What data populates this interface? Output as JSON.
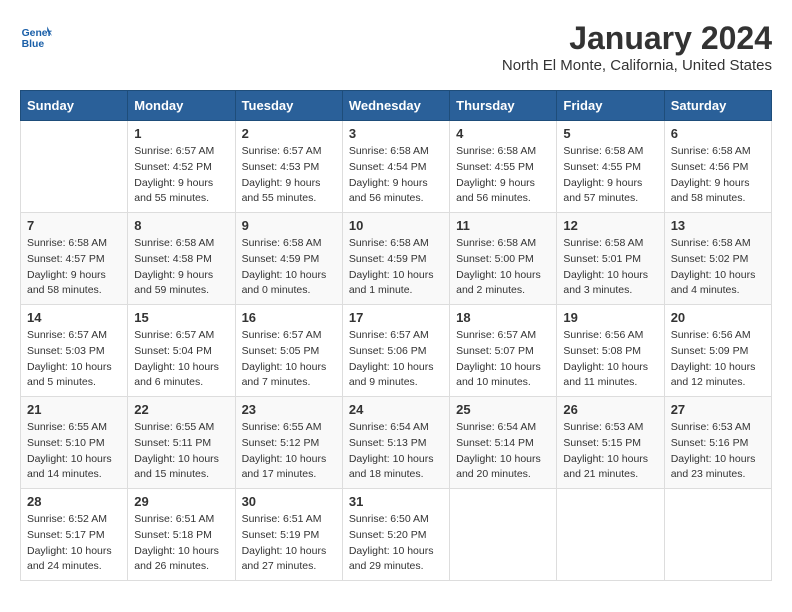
{
  "header": {
    "logo_line1": "General",
    "logo_line2": "Blue",
    "title": "January 2024",
    "subtitle": "North El Monte, California, United States"
  },
  "days_of_week": [
    "Sunday",
    "Monday",
    "Tuesday",
    "Wednesday",
    "Thursday",
    "Friday",
    "Saturday"
  ],
  "weeks": [
    [
      {
        "day": "",
        "info": ""
      },
      {
        "day": "1",
        "info": "Sunrise: 6:57 AM\nSunset: 4:52 PM\nDaylight: 9 hours\nand 55 minutes."
      },
      {
        "day": "2",
        "info": "Sunrise: 6:57 AM\nSunset: 4:53 PM\nDaylight: 9 hours\nand 55 minutes."
      },
      {
        "day": "3",
        "info": "Sunrise: 6:58 AM\nSunset: 4:54 PM\nDaylight: 9 hours\nand 56 minutes."
      },
      {
        "day": "4",
        "info": "Sunrise: 6:58 AM\nSunset: 4:55 PM\nDaylight: 9 hours\nand 56 minutes."
      },
      {
        "day": "5",
        "info": "Sunrise: 6:58 AM\nSunset: 4:55 PM\nDaylight: 9 hours\nand 57 minutes."
      },
      {
        "day": "6",
        "info": "Sunrise: 6:58 AM\nSunset: 4:56 PM\nDaylight: 9 hours\nand 58 minutes."
      }
    ],
    [
      {
        "day": "7",
        "info": "Sunrise: 6:58 AM\nSunset: 4:57 PM\nDaylight: 9 hours\nand 58 minutes."
      },
      {
        "day": "8",
        "info": "Sunrise: 6:58 AM\nSunset: 4:58 PM\nDaylight: 9 hours\nand 59 minutes."
      },
      {
        "day": "9",
        "info": "Sunrise: 6:58 AM\nSunset: 4:59 PM\nDaylight: 10 hours\nand 0 minutes."
      },
      {
        "day": "10",
        "info": "Sunrise: 6:58 AM\nSunset: 4:59 PM\nDaylight: 10 hours\nand 1 minute."
      },
      {
        "day": "11",
        "info": "Sunrise: 6:58 AM\nSunset: 5:00 PM\nDaylight: 10 hours\nand 2 minutes."
      },
      {
        "day": "12",
        "info": "Sunrise: 6:58 AM\nSunset: 5:01 PM\nDaylight: 10 hours\nand 3 minutes."
      },
      {
        "day": "13",
        "info": "Sunrise: 6:58 AM\nSunset: 5:02 PM\nDaylight: 10 hours\nand 4 minutes."
      }
    ],
    [
      {
        "day": "14",
        "info": "Sunrise: 6:57 AM\nSunset: 5:03 PM\nDaylight: 10 hours\nand 5 minutes."
      },
      {
        "day": "15",
        "info": "Sunrise: 6:57 AM\nSunset: 5:04 PM\nDaylight: 10 hours\nand 6 minutes."
      },
      {
        "day": "16",
        "info": "Sunrise: 6:57 AM\nSunset: 5:05 PM\nDaylight: 10 hours\nand 7 minutes."
      },
      {
        "day": "17",
        "info": "Sunrise: 6:57 AM\nSunset: 5:06 PM\nDaylight: 10 hours\nand 9 minutes."
      },
      {
        "day": "18",
        "info": "Sunrise: 6:57 AM\nSunset: 5:07 PM\nDaylight: 10 hours\nand 10 minutes."
      },
      {
        "day": "19",
        "info": "Sunrise: 6:56 AM\nSunset: 5:08 PM\nDaylight: 10 hours\nand 11 minutes."
      },
      {
        "day": "20",
        "info": "Sunrise: 6:56 AM\nSunset: 5:09 PM\nDaylight: 10 hours\nand 12 minutes."
      }
    ],
    [
      {
        "day": "21",
        "info": "Sunrise: 6:55 AM\nSunset: 5:10 PM\nDaylight: 10 hours\nand 14 minutes."
      },
      {
        "day": "22",
        "info": "Sunrise: 6:55 AM\nSunset: 5:11 PM\nDaylight: 10 hours\nand 15 minutes."
      },
      {
        "day": "23",
        "info": "Sunrise: 6:55 AM\nSunset: 5:12 PM\nDaylight: 10 hours\nand 17 minutes."
      },
      {
        "day": "24",
        "info": "Sunrise: 6:54 AM\nSunset: 5:13 PM\nDaylight: 10 hours\nand 18 minutes."
      },
      {
        "day": "25",
        "info": "Sunrise: 6:54 AM\nSunset: 5:14 PM\nDaylight: 10 hours\nand 20 minutes."
      },
      {
        "day": "26",
        "info": "Sunrise: 6:53 AM\nSunset: 5:15 PM\nDaylight: 10 hours\nand 21 minutes."
      },
      {
        "day": "27",
        "info": "Sunrise: 6:53 AM\nSunset: 5:16 PM\nDaylight: 10 hours\nand 23 minutes."
      }
    ],
    [
      {
        "day": "28",
        "info": "Sunrise: 6:52 AM\nSunset: 5:17 PM\nDaylight: 10 hours\nand 24 minutes."
      },
      {
        "day": "29",
        "info": "Sunrise: 6:51 AM\nSunset: 5:18 PM\nDaylight: 10 hours\nand 26 minutes."
      },
      {
        "day": "30",
        "info": "Sunrise: 6:51 AM\nSunset: 5:19 PM\nDaylight: 10 hours\nand 27 minutes."
      },
      {
        "day": "31",
        "info": "Sunrise: 6:50 AM\nSunset: 5:20 PM\nDaylight: 10 hours\nand 29 minutes."
      },
      {
        "day": "",
        "info": ""
      },
      {
        "day": "",
        "info": ""
      },
      {
        "day": "",
        "info": ""
      }
    ]
  ]
}
